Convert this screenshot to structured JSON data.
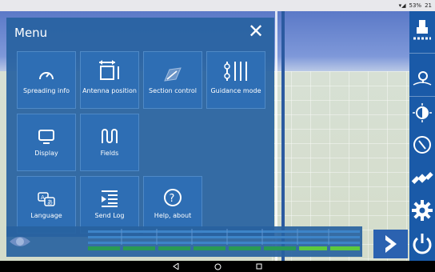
{
  "status_bar": {
    "battery": "53%",
    "time": "21"
  },
  "menu": {
    "title": "Menu",
    "tiles": [
      {
        "label": "Spreading info",
        "icon": "speedometer-icon"
      },
      {
        "label": "Antenna position",
        "icon": "antenna-position-icon"
      },
      {
        "label": "Section control",
        "icon": "section-control-icon"
      },
      {
        "label": "Guidance mode",
        "icon": "guidance-mode-icon"
      },
      {
        "label": "Display",
        "icon": "monitor-icon"
      },
      {
        "label": "Fields",
        "icon": "fields-icon"
      },
      {
        "label": "Language",
        "icon": "language-icon"
      },
      {
        "label": "Send Log",
        "icon": "send-log-icon"
      },
      {
        "label": "Help, about",
        "icon": "help-icon"
      }
    ]
  },
  "right_toolbar": [
    "tractor-icon",
    "location-pin-icon",
    "day-night-icon",
    "compass-icon",
    "satellite-icon",
    "settings-icon",
    "power-icon"
  ],
  "colors": {
    "menu_bg": "#2862a0",
    "tile_bg": "#2e6eb4",
    "toolbar_bg": "#1a5aa8",
    "lightbar_green": "#5cc93e"
  }
}
